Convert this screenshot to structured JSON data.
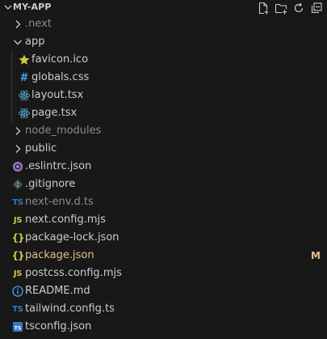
{
  "explorer": {
    "title": "MY-APP",
    "actions": [
      "new-file",
      "new-folder",
      "refresh",
      "collapse-all"
    ]
  },
  "tree": [
    {
      "label": ".next",
      "type": "folder",
      "state": "collapsed",
      "depth": 0,
      "muted": true
    },
    {
      "label": "app",
      "type": "folder",
      "state": "expanded",
      "depth": 0
    },
    {
      "label": "favicon.ico",
      "type": "file",
      "icon": "star",
      "depth": 1
    },
    {
      "label": "globals.css",
      "type": "file",
      "icon": "css-hash",
      "depth": 1
    },
    {
      "label": "layout.tsx",
      "type": "file",
      "icon": "react",
      "depth": 1
    },
    {
      "label": "page.tsx",
      "type": "file",
      "icon": "react",
      "depth": 1
    },
    {
      "label": "node_modules",
      "type": "folder",
      "state": "collapsed",
      "depth": 0,
      "muted": true
    },
    {
      "label": "public",
      "type": "folder",
      "state": "collapsed",
      "depth": 0
    },
    {
      "label": ".eslintrc.json",
      "type": "file",
      "icon": "eslint",
      "depth": 0
    },
    {
      "label": ".gitignore",
      "type": "file",
      "icon": "git",
      "depth": 0
    },
    {
      "label": "next-env.d.ts",
      "type": "file",
      "icon": "ts",
      "depth": 0,
      "muted": true
    },
    {
      "label": "next.config.mjs",
      "type": "file",
      "icon": "js",
      "depth": 0
    },
    {
      "label": "package-lock.json",
      "type": "file",
      "icon": "json",
      "depth": 0
    },
    {
      "label": "package.json",
      "type": "file",
      "icon": "json",
      "depth": 0,
      "modified": true,
      "badge": "M"
    },
    {
      "label": "postcss.config.mjs",
      "type": "file",
      "icon": "js",
      "depth": 0
    },
    {
      "label": "README.md",
      "type": "file",
      "icon": "info",
      "depth": 0
    },
    {
      "label": "tailwind.config.ts",
      "type": "file",
      "icon": "ts",
      "depth": 0
    },
    {
      "label": "tsconfig.json",
      "type": "file",
      "icon": "tsconfig",
      "depth": 0
    }
  ],
  "colors": {
    "background": "#181818",
    "text": "#cccccc",
    "muted": "#8b8b8b",
    "modified": "#e2c08d",
    "typescript": "#3178c6",
    "javascript": "#cbcb41",
    "react": "#519aba"
  }
}
